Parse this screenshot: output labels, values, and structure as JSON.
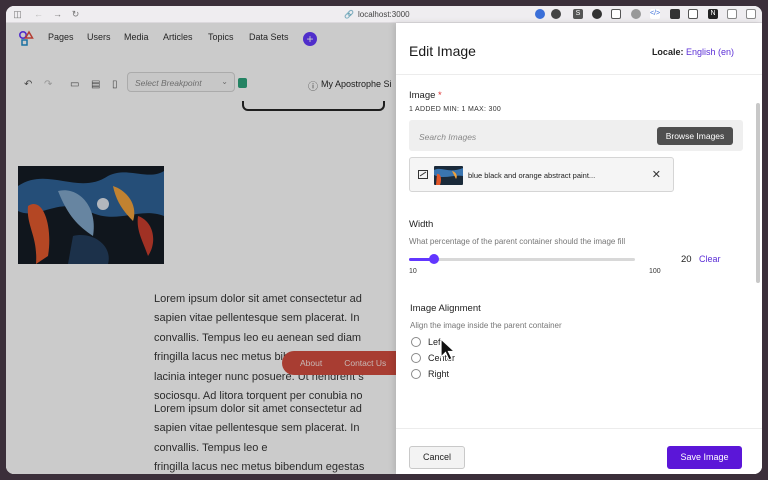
{
  "browser": {
    "url": "localhost:3000"
  },
  "nav": {
    "items": [
      "Pages",
      "Users",
      "Media",
      "Articles",
      "Topics",
      "Data Sets"
    ]
  },
  "toolbar": {
    "breakpoint_placeholder": "Select Breakpoint",
    "site_title": "My Apostrophe Si"
  },
  "canvas": {
    "paragraph1": [
      "Lorem ipsum dolor sit amet consectetur ad",
      "sapien vitae pellentesque sem placerat. In",
      "convallis. Tempus leo eu aenean sed diam",
      "fringilla lacus nec metus bibendum egestas",
      "lacinia integer nunc posuere. Ut hendrerit s",
      "sociosqu. Ad litora torquent per conubia no"
    ],
    "paragraph2": [
      "Lorem ipsum dolor sit amet consectetur ad",
      "sapien vitae pellentesque sem placerat. In",
      "convallis. Tempus leo e",
      "fringilla lacus nec metus bibendum egestas"
    ],
    "footer_links": [
      "About",
      "Contact Us"
    ]
  },
  "modal": {
    "title": "Edit Image",
    "locale_label": "Locale:",
    "locale_value": "English (en)",
    "image_field": {
      "label": "Image",
      "required_mark": "*",
      "meta": "1 ADDED   MIN: 1   MAX: 300",
      "search_placeholder": "Search Images",
      "browse_label": "Browse Images",
      "attached_name": "blue black and orange abstract paint..."
    },
    "width_field": {
      "label": "Width",
      "help": "What percentage of the parent container should the image fill",
      "min": "10",
      "max": "100",
      "value": "20",
      "clear_label": "Clear"
    },
    "alignment_field": {
      "label": "Image Alignment",
      "help": "Align the image inside the parent container",
      "options": [
        "Left",
        "Center",
        "Right"
      ]
    },
    "cancel_label": "Cancel",
    "save_label": "Save Image"
  },
  "colors": {
    "accent": "#6236ff",
    "save": "#5b16d8",
    "footer": "#d24a3b"
  }
}
